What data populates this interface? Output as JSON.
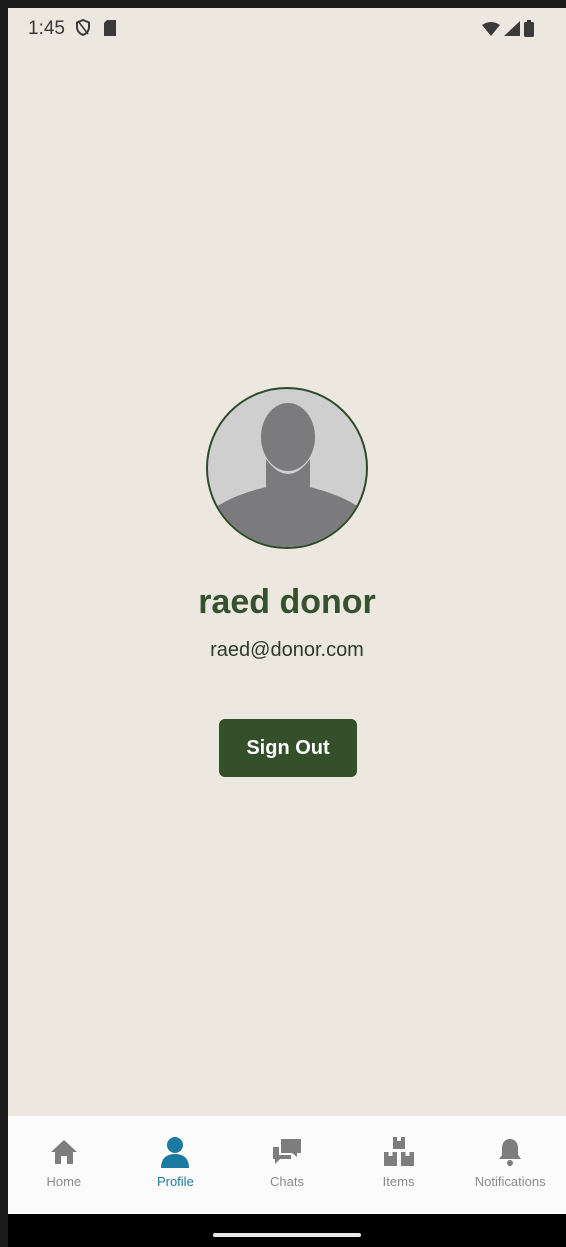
{
  "status_bar": {
    "time": "1:45",
    "left_icons": [
      "shield-icon",
      "sd-card-icon"
    ],
    "right_icons": [
      "wifi-icon",
      "signal-icon",
      "battery-icon"
    ]
  },
  "profile": {
    "name": "raed donor",
    "email": "raed@donor.com",
    "avatar_icon": "person-silhouette-icon"
  },
  "actions": {
    "sign_out_label": "Sign Out"
  },
  "bottom_nav": {
    "items": [
      {
        "label": "Home",
        "icon": "home-icon",
        "active": false
      },
      {
        "label": "Profile",
        "icon": "person-icon",
        "active": true
      },
      {
        "label": "Chats",
        "icon": "chat-icon",
        "active": false
      },
      {
        "label": "Items",
        "icon": "boxes-icon",
        "active": false
      },
      {
        "label": "Notifications",
        "icon": "bell-icon",
        "active": false
      }
    ]
  },
  "colors": {
    "background": "#ede8df",
    "primary_green": "#34502b",
    "active_nav": "#1c7aa0",
    "inactive_nav": "#8b8b8b"
  }
}
